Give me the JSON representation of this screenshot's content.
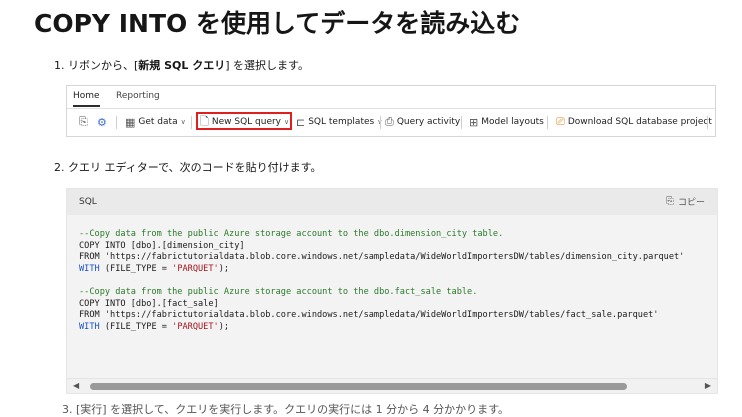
{
  "page": {
    "title": "COPY INTO を使用してデータを読み込む"
  },
  "steps": {
    "step1": {
      "number": "1.",
      "text_before": "リボンから、[",
      "bold": "新規 SQL クエリ",
      "text_after": "] を選択します。"
    },
    "step2": {
      "number": "2.",
      "text": "クエリ エディターで、次のコードを貼り付けます。"
    },
    "step3": {
      "number": "3.",
      "text": "[実行] を選択して、クエリを実行します。クエリの実行には 1 分から 4 分かかります。"
    }
  },
  "ribbon": {
    "tabs": [
      {
        "label": "Home",
        "active": true
      },
      {
        "label": "Reporting",
        "active": false
      }
    ],
    "buttons": {
      "get_data": "Get data",
      "new_sql_query": "New SQL query",
      "sql_templates": "SQL templates",
      "query_activity": "Query activity",
      "model_layouts": "Model layouts",
      "download_project": "Download SQL database project"
    },
    "highlight_color": "#e02020"
  },
  "code_block": {
    "language": "SQL",
    "copy_label": "コピー",
    "lines": [
      {
        "type": "comment",
        "text": "--Copy data from the public Azure storage account to the dbo.dimension_city table."
      },
      {
        "type": "plain",
        "text": "COPY INTO [dbo].[dimension_city]"
      },
      {
        "type": "plain",
        "text": "FROM 'https://fabrictutorialdata.blob.core.windows.net/sampledata/WideWorldImportersDW/tables/dimension_city.parquet'"
      },
      {
        "type": "with",
        "kw": "WITH",
        "mid": " (FILE_TYPE = ",
        "str": "'PARQUET'",
        "end": ");"
      },
      {
        "type": "blank",
        "text": ""
      },
      {
        "type": "comment",
        "text": "--Copy data from the public Azure storage account to the dbo.fact_sale table."
      },
      {
        "type": "plain",
        "text": "COPY INTO [dbo].[fact_sale]"
      },
      {
        "type": "plain",
        "text": "FROM 'https://fabrictutorialdata.blob.core.windows.net/sampledata/WideWorldImportersDW/tables/fact_sale.parquet'"
      },
      {
        "type": "with",
        "kw": "WITH",
        "mid": " (FILE_TYPE = ",
        "str": "'PARQUET'",
        "end": ");"
      }
    ],
    "colors": {
      "comment": "#2a7a2a",
      "keyword": "#1a52c8",
      "string": "#a3151d"
    }
  }
}
